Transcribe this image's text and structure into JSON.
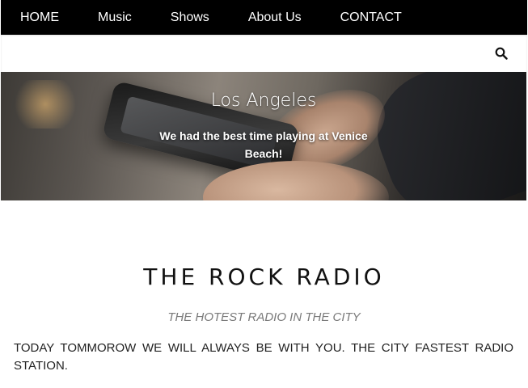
{
  "nav": {
    "items": [
      "HOME",
      "Music",
      "Shows",
      "About Us",
      "CONTACT"
    ]
  },
  "search": {
    "icon": "search-icon"
  },
  "hero": {
    "title": "Los Angeles",
    "caption": "We had the best time playing at Venice Beach!"
  },
  "site": {
    "title": "THE ROCK RADIO",
    "tagline": "THE HOTEST RADIO IN THE CITY",
    "body": "TODAY TOMMOROW WE WILL ALWAYS BE WITH YOU. THE CITY FASTEST RADIO STATION."
  },
  "colors": {
    "nav_bg": "#000000",
    "nav_text": "#ffffff",
    "tagline": "#7a7a7a"
  }
}
